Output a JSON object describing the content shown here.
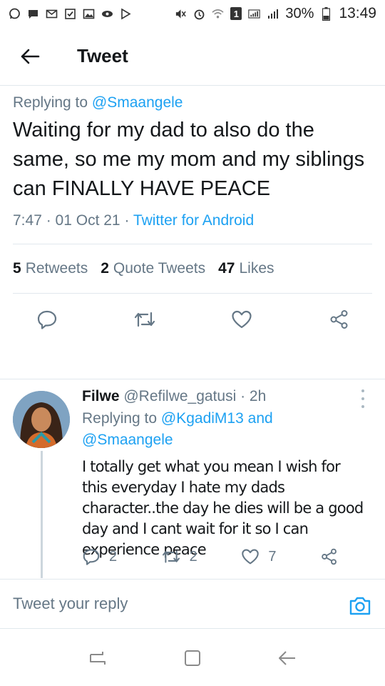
{
  "status_bar": {
    "battery": "30%",
    "time": "13:49",
    "sim_badge": "1"
  },
  "header": {
    "title": "Tweet"
  },
  "main_tweet": {
    "replying_prefix": "Replying to",
    "replying_handle": "@Smaangele",
    "text": "Waiting for my dad to also do the same, so me my mom and my siblings can FINALLY HAVE PEACE",
    "time": "7:47",
    "date": "01 Oct 21",
    "source": "Twitter for Android",
    "retweets_count": "5",
    "retweets_label": "Retweets",
    "quotes_count": "2",
    "quotes_label": "Quote Tweets",
    "likes_count": "47",
    "likes_label": "Likes"
  },
  "reply": {
    "name": "Filwe",
    "handle": "@Refilwe_gatusi",
    "age": "2h",
    "replying_prefix": "Replying to",
    "replying_handle_1": "@KgadiM13",
    "replying_and": "and",
    "replying_handle_2": "@Smaangele",
    "text": "I totally get what you mean I wish for this everyday I hate my dads character..the day he dies will be a good day and I cant wait for it so I can experience peace",
    "reply_count": "2",
    "retweet_count": "2",
    "like_count": "7"
  },
  "compose": {
    "placeholder": "Tweet your reply"
  },
  "colors": {
    "accent": "#1da1f2",
    "secondary_text": "#657786",
    "divider": "#e1e8ed"
  }
}
